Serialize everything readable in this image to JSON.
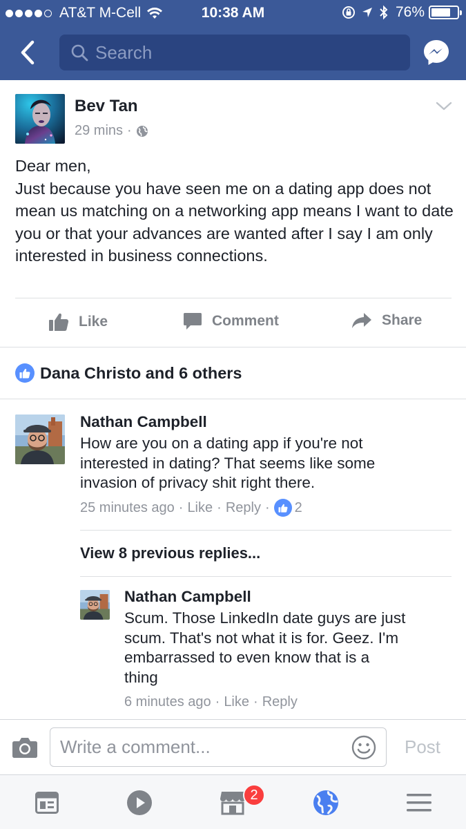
{
  "status_bar": {
    "carrier": "AT&T M-Cell",
    "time": "10:38 AM",
    "battery_percent": "76%",
    "battery_level": 0.76
  },
  "header": {
    "search_placeholder": "Search"
  },
  "post": {
    "author": "Bev Tan",
    "time": "29 mins",
    "separator": "·",
    "body": "Dear men,\nJust because you have seen me on a dating app does not mean us matching on a networking app means I want to date you or that your advances are wanted after I say I am only interested in business connections.",
    "actions": {
      "like": "Like",
      "comment": "Comment",
      "share": "Share"
    },
    "likes_summary": "Dana Christo and 6 others"
  },
  "comments": [
    {
      "author": "Nathan Campbell",
      "text": "How are you on a dating app if you're not\ninterested in dating? That seems like some\ninvasion of privacy shit right there.",
      "time": "25 minutes ago",
      "like": "Like",
      "reply": "Reply",
      "like_count": "2"
    }
  ],
  "view_previous": "View 8 previous replies...",
  "reply": {
    "author": "Nathan Campbell",
    "text": "Scum. Those LinkedIn date guys are just\nscum. That's not what it is for. Geez. I'm\nembarrassed to even know that is a\nthing",
    "time": "6 minutes ago",
    "like": "Like",
    "reply": "Reply"
  },
  "composer": {
    "placeholder": "Write a comment...",
    "post_label": "Post"
  },
  "tabbar": {
    "marketplace_badge": "2"
  },
  "colors": {
    "brand": "#3b5998",
    "like_blue": "#5890ff",
    "badge_red": "#fa3e3e",
    "muted_text": "#90949c"
  }
}
